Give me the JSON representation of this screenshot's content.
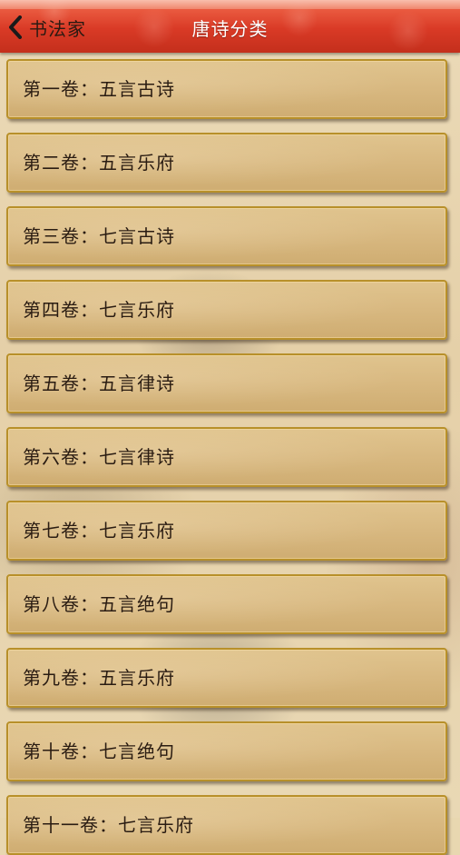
{
  "header": {
    "back_label": "书法家",
    "title": "唐诗分类"
  },
  "list": {
    "items": [
      {
        "label": "第一卷：五言古诗"
      },
      {
        "label": "第二卷：五言乐府"
      },
      {
        "label": "第三卷：七言古诗"
      },
      {
        "label": "第四卷：七言乐府"
      },
      {
        "label": "第五卷：五言律诗"
      },
      {
        "label": "第六卷：七言律诗"
      },
      {
        "label": "第七卷：七言乐府"
      },
      {
        "label": "第八卷：五言绝句"
      },
      {
        "label": "第九卷：五言乐府"
      },
      {
        "label": "第十卷：七言绝句"
      },
      {
        "label": "第十一卷：七言乐府"
      }
    ]
  },
  "colors": {
    "header_red": "#d93a26",
    "card_border_gold": "#b8902a",
    "card_fill": "#d8b880",
    "title_text": "#ffffff",
    "item_text": "#2a1c12"
  },
  "icons": {
    "back": "chevron-left-icon"
  }
}
